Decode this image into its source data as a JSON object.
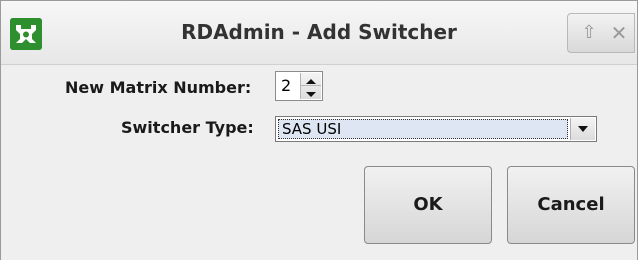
{
  "window": {
    "title": "RDAdmin - Add Switcher",
    "app_icon": "rdadmin-logo-icon",
    "controls": {
      "maximize_glyph": "⇧",
      "close_glyph": "✕"
    }
  },
  "form": {
    "matrix_number_label": "New Matrix Number:",
    "matrix_number_value": "2",
    "switcher_type_label": "Switcher Type:",
    "switcher_type_value": "SAS USI"
  },
  "buttons": {
    "ok_label": "OK",
    "cancel_label": "Cancel"
  },
  "colors": {
    "app_icon_bg": "#2e8f2e",
    "combo_selection_bg": "#dde6f2"
  }
}
